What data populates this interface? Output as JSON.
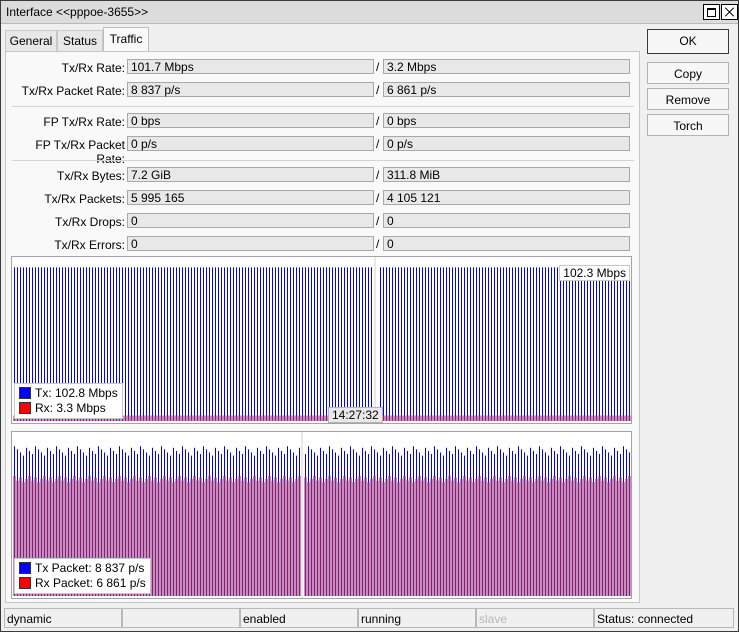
{
  "window": {
    "title": "Interface <<pppoe-3655>>"
  },
  "tabs": [
    {
      "label": "General",
      "active": false
    },
    {
      "label": "Status",
      "active": false
    },
    {
      "label": "Traffic",
      "active": true
    }
  ],
  "traffic": {
    "tx_rx_rate": {
      "label": "Tx/Rx Rate:",
      "tx": "101.7 Mbps",
      "rx": "3.2 Mbps"
    },
    "tx_rx_packet_rate": {
      "label": "Tx/Rx Packet Rate:",
      "tx": "8 837 p/s",
      "rx": "6 861 p/s"
    },
    "fp_tx_rx_rate": {
      "label": "FP Tx/Rx Rate:",
      "tx": "0 bps",
      "rx": "0 bps"
    },
    "fp_tx_rx_packet_rate": {
      "label": "FP Tx/Rx Packet Rate:",
      "tx": "0 p/s",
      "rx": "0 p/s"
    },
    "tx_rx_bytes": {
      "label": "Tx/Rx Bytes:",
      "tx": "7.2 GiB",
      "rx": "311.8 MiB"
    },
    "tx_rx_packets": {
      "label": "Tx/Rx Packets:",
      "tx": "5 995 165",
      "rx": "4 105 121"
    },
    "tx_rx_drops": {
      "label": "Tx/Rx Drops:",
      "tx": "0",
      "rx": "0"
    },
    "tx_rx_errors": {
      "label": "Tx/Rx Errors:",
      "tx": "0",
      "rx": "0"
    },
    "separator": "/"
  },
  "rate_graph": {
    "max_label": "102.3 Mbps",
    "time_label": "14:27:32",
    "legend_tx": "Tx:  102.8 Mbps",
    "legend_rx": "Rx:  3.3 Mbps",
    "tx_color": "#0000ff",
    "rx_color": "#ff0000",
    "tx_level": 0.985,
    "rx_level": 0.035
  },
  "packet_graph": {
    "legend_tx": "Tx Packet:  8 837 p/s",
    "legend_rx": "Rx Packet:  6 861 p/s",
    "tx_color": "#0000ff",
    "rx_color": "#ff0000",
    "tx_level": 0.96,
    "rx_level": 0.77
  },
  "buttons": {
    "ok": "OK",
    "copy": "Copy",
    "remove": "Remove",
    "torch": "Torch"
  },
  "statusbar": {
    "dynamic": "dynamic",
    "empty": "",
    "enabled": "enabled",
    "running": "running",
    "slave": "slave",
    "status": "Status: connected"
  }
}
